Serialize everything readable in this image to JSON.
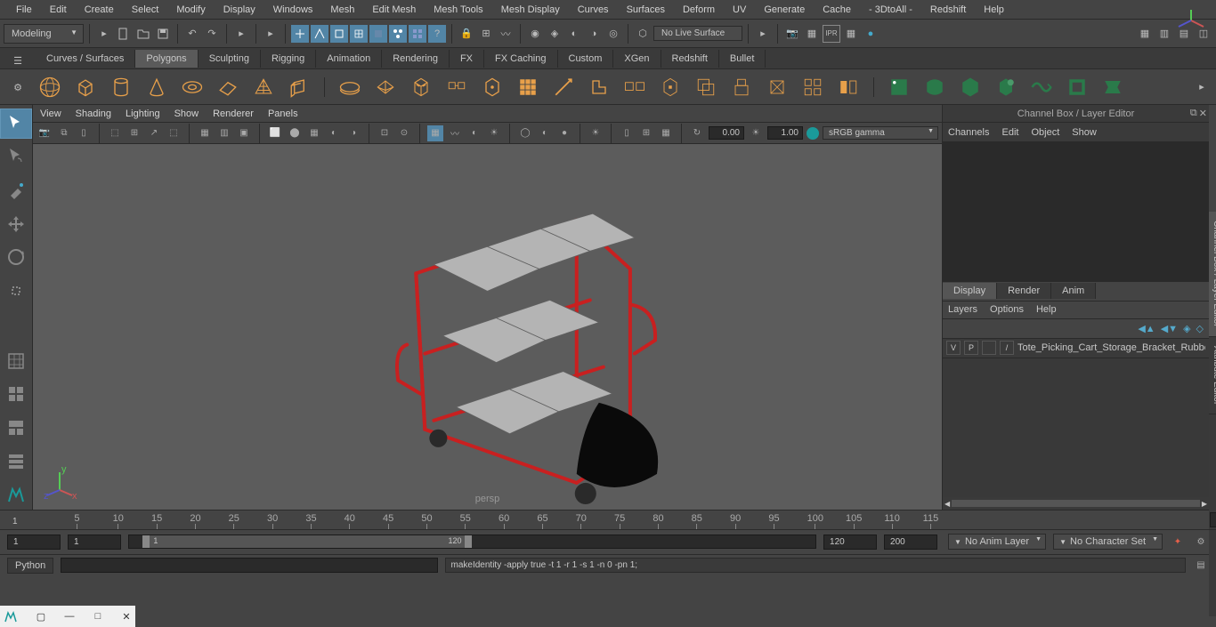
{
  "menubar": [
    "File",
    "Edit",
    "Create",
    "Select",
    "Modify",
    "Display",
    "Windows",
    "Mesh",
    "Edit Mesh",
    "Mesh Tools",
    "Mesh Display",
    "Curves",
    "Surfaces",
    "Deform",
    "UV",
    "Generate",
    "Cache",
    "- 3DtoAll -",
    "Redshift",
    "Help"
  ],
  "workspace": "Modeling",
  "noLiveSurface": "No Live Surface",
  "shelfTabs": [
    "Curves / Surfaces",
    "Polygons",
    "Sculpting",
    "Rigging",
    "Animation",
    "Rendering",
    "FX",
    "FX Caching",
    "Custom",
    "XGen",
    "Redshift",
    "Bullet"
  ],
  "activeShelfTab": "Polygons",
  "viewportMenus": [
    "View",
    "Shading",
    "Lighting",
    "Show",
    "Renderer",
    "Panels"
  ],
  "vpValue1": "0.00",
  "vpValue2": "1.00",
  "colorSpace": "sRGB gamma",
  "viewportLabel": "persp",
  "channelBoxTitle": "Channel Box / Layer Editor",
  "channelTabs": [
    "Channels",
    "Edit",
    "Object",
    "Show"
  ],
  "displayTabs": [
    "Display",
    "Render",
    "Anim"
  ],
  "layersMenu": [
    "Layers",
    "Options",
    "Help"
  ],
  "layerName": "Tote_Picking_Cart_Storage_Bracket_Rubber",
  "layerFlags": [
    "V",
    "P",
    "",
    "/"
  ],
  "vertTabs": [
    "Channel Box / Layer Editor",
    "Attribute Editor"
  ],
  "timeStart": "1",
  "timeCurrent": "1",
  "timeRulerStart": "1",
  "timeRulerLabels": [
    "5",
    "10",
    "15",
    "20",
    "25",
    "30",
    "35",
    "40",
    "45",
    "50",
    "55",
    "60",
    "65",
    "70",
    "75",
    "80",
    "85",
    "90",
    "95",
    "100",
    "105",
    "110",
    "115"
  ],
  "rangeStart": "1",
  "rangeEnd": "120",
  "rangeEndOuter": "120",
  "fps": "200",
  "animLayer": "No Anim Layer",
  "characterSet": "No Character Set",
  "cmdLang": "Python",
  "cmdOutput": "makeIdentity -apply true -t 1 -r 1 -s 1 -n 0 -pn 1;"
}
